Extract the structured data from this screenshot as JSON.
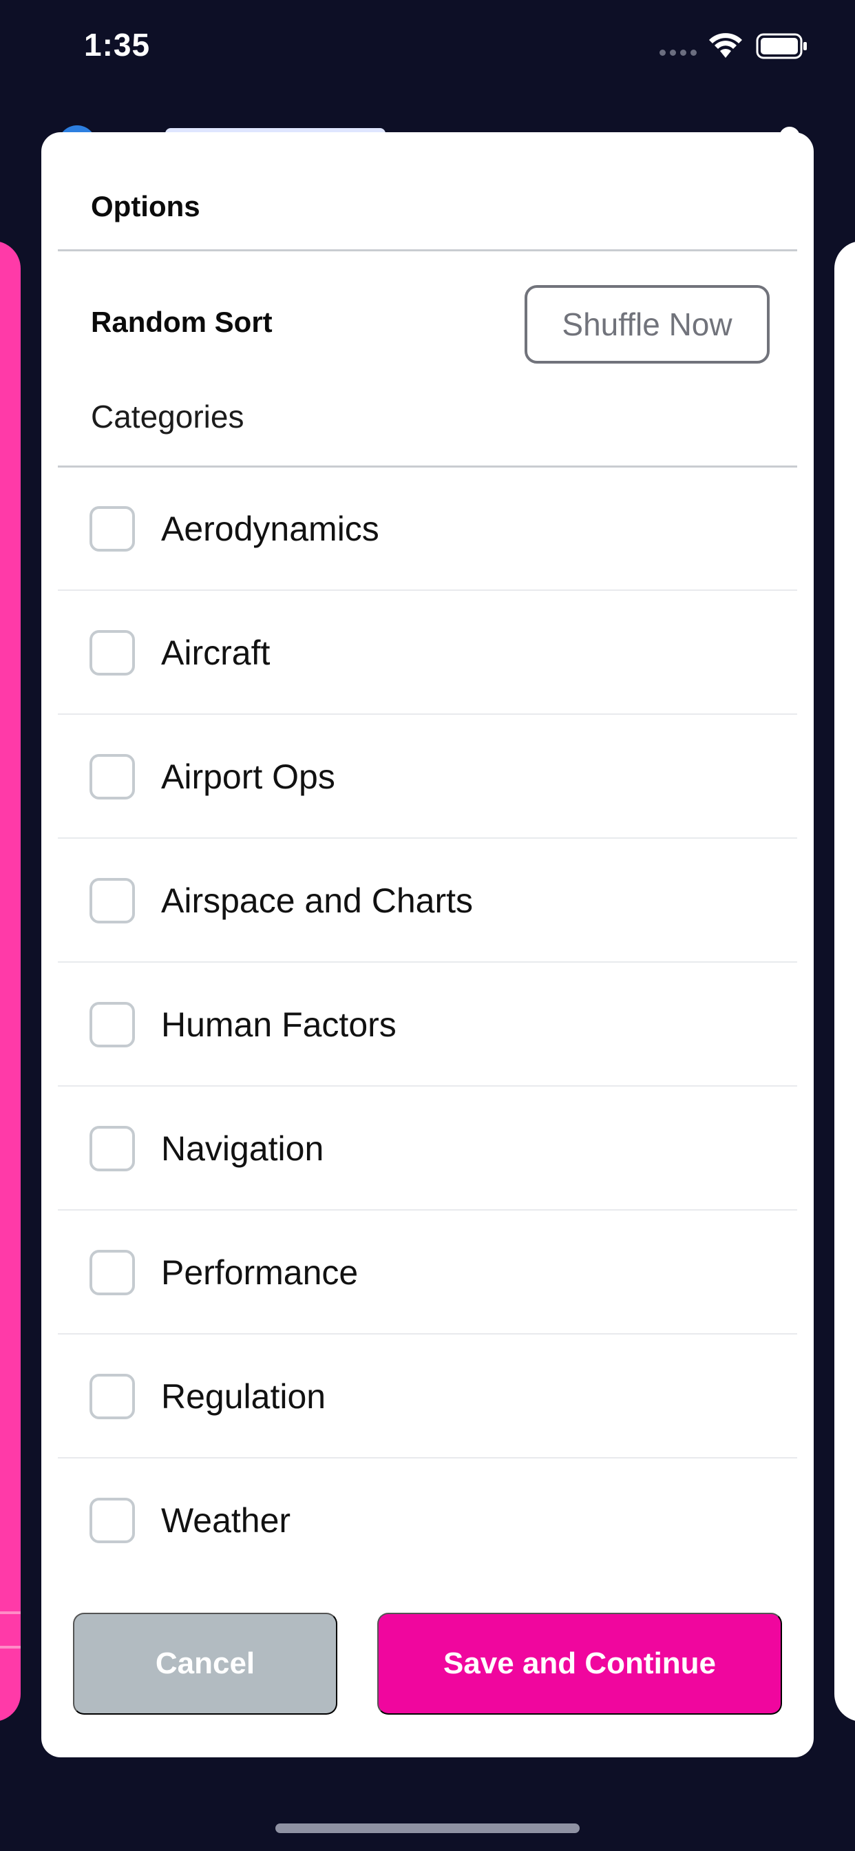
{
  "status_bar": {
    "time": "1:35"
  },
  "modal": {
    "title": "Options",
    "random_sort_label": "Random Sort",
    "shuffle_button_label": "Shuffle Now",
    "categories_label": "Categories",
    "categories": [
      {
        "label": "Aerodynamics",
        "checked": false
      },
      {
        "label": "Aircraft",
        "checked": false
      },
      {
        "label": "Airport Ops",
        "checked": false
      },
      {
        "label": "Airspace and Charts",
        "checked": false
      },
      {
        "label": "Human Factors",
        "checked": false
      },
      {
        "label": "Navigation",
        "checked": false
      },
      {
        "label": "Performance",
        "checked": false
      },
      {
        "label": "Regulation",
        "checked": false
      },
      {
        "label": "Weather",
        "checked": false
      }
    ],
    "cancel_label": "Cancel",
    "save_label": "Save and Continue"
  },
  "colors": {
    "background": "#0d0f26",
    "accent": "#f0069e",
    "cancel": "#b2bbc1",
    "left_card": "#ff3aa8"
  }
}
